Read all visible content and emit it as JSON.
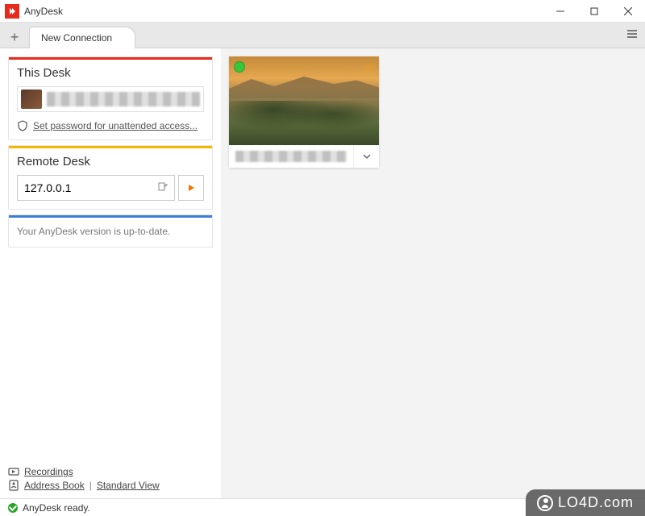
{
  "app": {
    "title": "AnyDesk"
  },
  "tabs": {
    "new_connection": "New Connection"
  },
  "this_desk": {
    "title": "This Desk",
    "password_link": "Set password for unattended access..."
  },
  "remote_desk": {
    "title": "Remote Desk",
    "address": "127.0.0.1"
  },
  "update": {
    "message": "Your AnyDesk version is up-to-date."
  },
  "links": {
    "recordings": "Recordings",
    "address_book": "Address Book",
    "standard_view": "Standard View"
  },
  "status": {
    "text": "AnyDesk ready."
  },
  "recent": {
    "online": true,
    "favorite": true
  },
  "watermark": "LO4D.com"
}
